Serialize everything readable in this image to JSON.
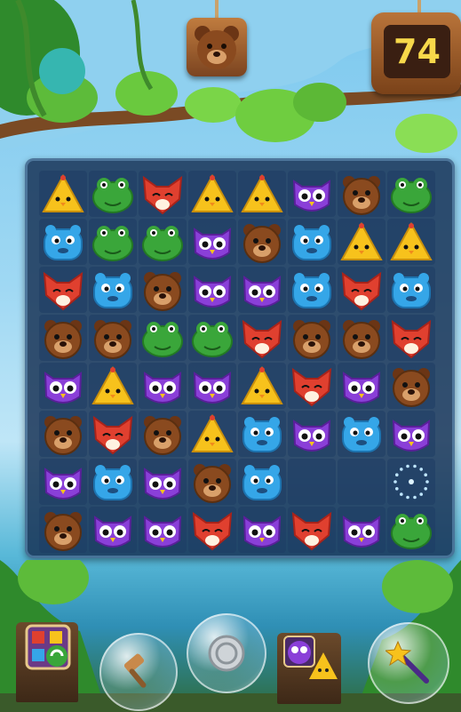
{
  "timer": {
    "value": "74"
  },
  "goal": {
    "icon": "bear-face-icon"
  },
  "colors": {
    "yellow": "#f7c21c",
    "green": "#3aa63a",
    "red": "#e0402f",
    "purple": "#8a3fd8",
    "blue": "#35a6e8",
    "brown": "#8a4a1f"
  },
  "board": {
    "rows": 8,
    "cols": 8,
    "grid": [
      [
        "yellow",
        "green",
        "red",
        "yellow",
        "yellow",
        "purple",
        "brown",
        "green"
      ],
      [
        "blue",
        "green",
        "green",
        "purple",
        "brown",
        "blue",
        "yellow",
        "yellow"
      ],
      [
        "red",
        "blue",
        "brown",
        "purple",
        "purple",
        "blue",
        "red",
        "blue"
      ],
      [
        "brown",
        "brown",
        "green",
        "green",
        "red",
        "brown",
        "brown",
        "red"
      ],
      [
        "purple",
        "yellow",
        "purple",
        "purple",
        "yellow",
        "red",
        "purple",
        "brown"
      ],
      [
        "brown",
        "red",
        "brown",
        "yellow",
        "blue",
        "purple",
        "blue",
        "purple"
      ],
      [
        "purple",
        "blue",
        "purple",
        "brown",
        "blue",
        "empty",
        "empty",
        "sparkle"
      ],
      [
        "brown",
        "purple",
        "purple",
        "red",
        "purple",
        "red",
        "purple",
        "green"
      ]
    ]
  },
  "tools": [
    {
      "id": "shuffle",
      "icon": "shuffle-board-icon"
    },
    {
      "id": "hammer",
      "icon": "hammer-icon"
    },
    {
      "id": "coin",
      "icon": "silver-coin-icon"
    },
    {
      "id": "swap",
      "icon": "swap-pieces-icon"
    },
    {
      "id": "magic-wand",
      "icon": "magic-wand-icon"
    }
  ]
}
